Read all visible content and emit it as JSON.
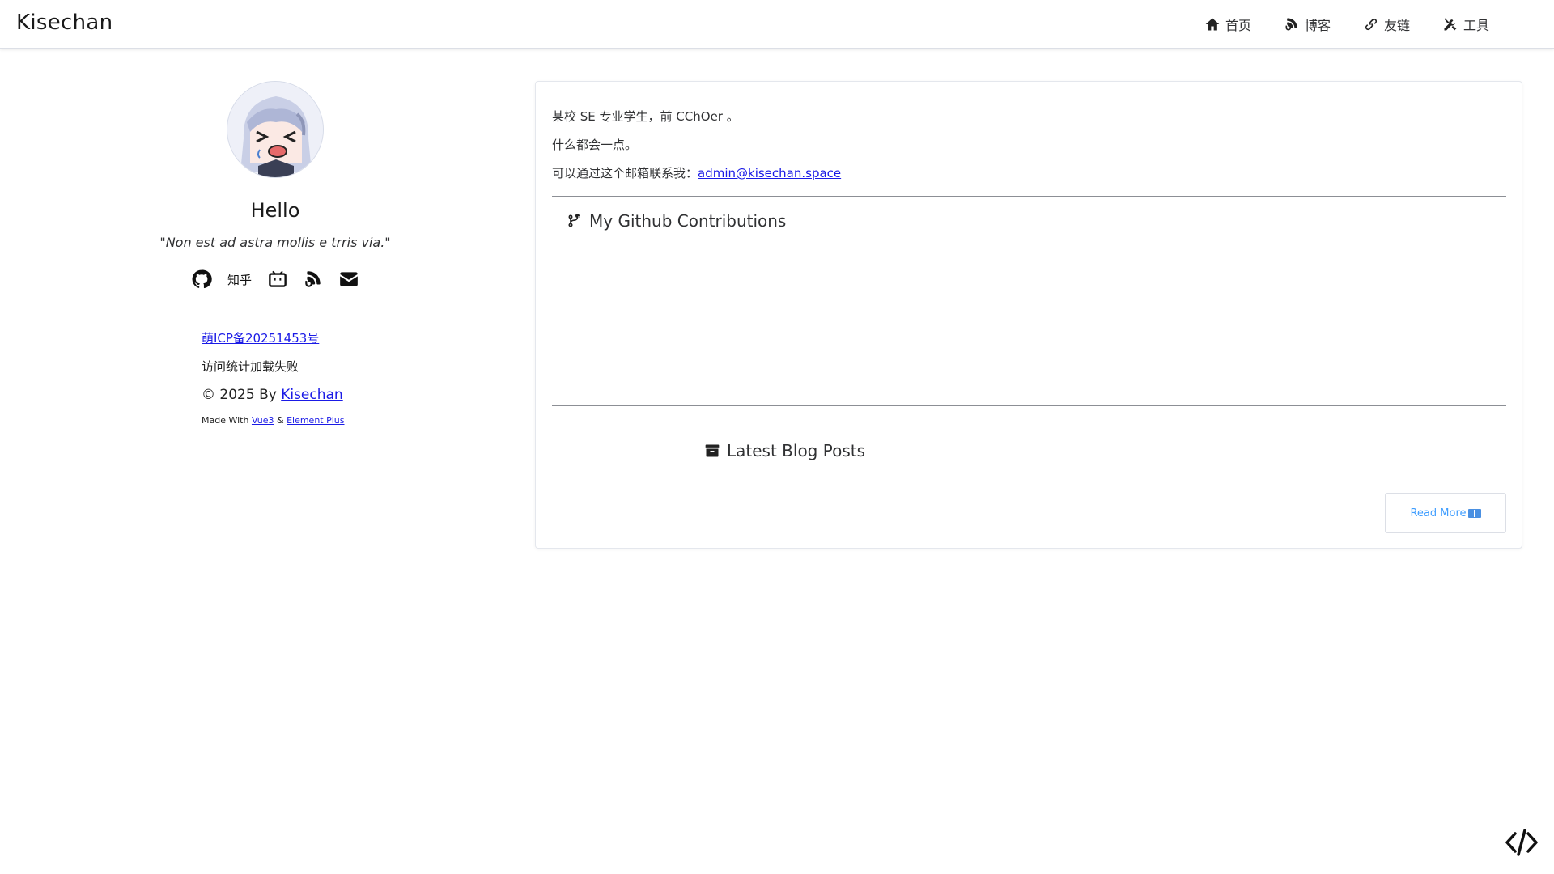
{
  "header": {
    "brand": "Kisechan",
    "nav": [
      {
        "label": "首页",
        "icon": "home-icon"
      },
      {
        "label": "博客",
        "icon": "blog-icon"
      },
      {
        "label": "友链",
        "icon": "link-icon"
      },
      {
        "label": "工具",
        "icon": "tools-icon"
      }
    ]
  },
  "profile": {
    "greeting": "Hello",
    "motto": "\"Non est ad astra mollis e trris via.\"",
    "socials": [
      {
        "icon": "github-icon"
      },
      {
        "label": "知乎",
        "icon": "zhihu-text"
      },
      {
        "icon": "bilibili-icon"
      },
      {
        "icon": "blog-icon"
      },
      {
        "icon": "email-icon"
      }
    ]
  },
  "footer": {
    "icp": "萌ICP备20251453号",
    "visit_status": "访问统计加载失败",
    "copyright_prefix": "© 2025 By ",
    "copyright_name": "Kisechan",
    "made_with_prefix": "Made With ",
    "vue": "Vue3",
    "amp": " & ",
    "element": "Element Plus"
  },
  "card": {
    "intro_line1": "某校 SE 专业学生，前 CChOer 。",
    "intro_line2": "什么都会一点。",
    "intro_line3_prefix": "可以通过这个邮箱联系我：",
    "email": "admin@kisechan.space",
    "github_title": "My Github Contributions",
    "blog_title": "Latest Blog Posts",
    "read_more": "Read More"
  },
  "colors": {
    "link": "#1a1ae6",
    "accent": "#409eff",
    "text": "#303133"
  }
}
